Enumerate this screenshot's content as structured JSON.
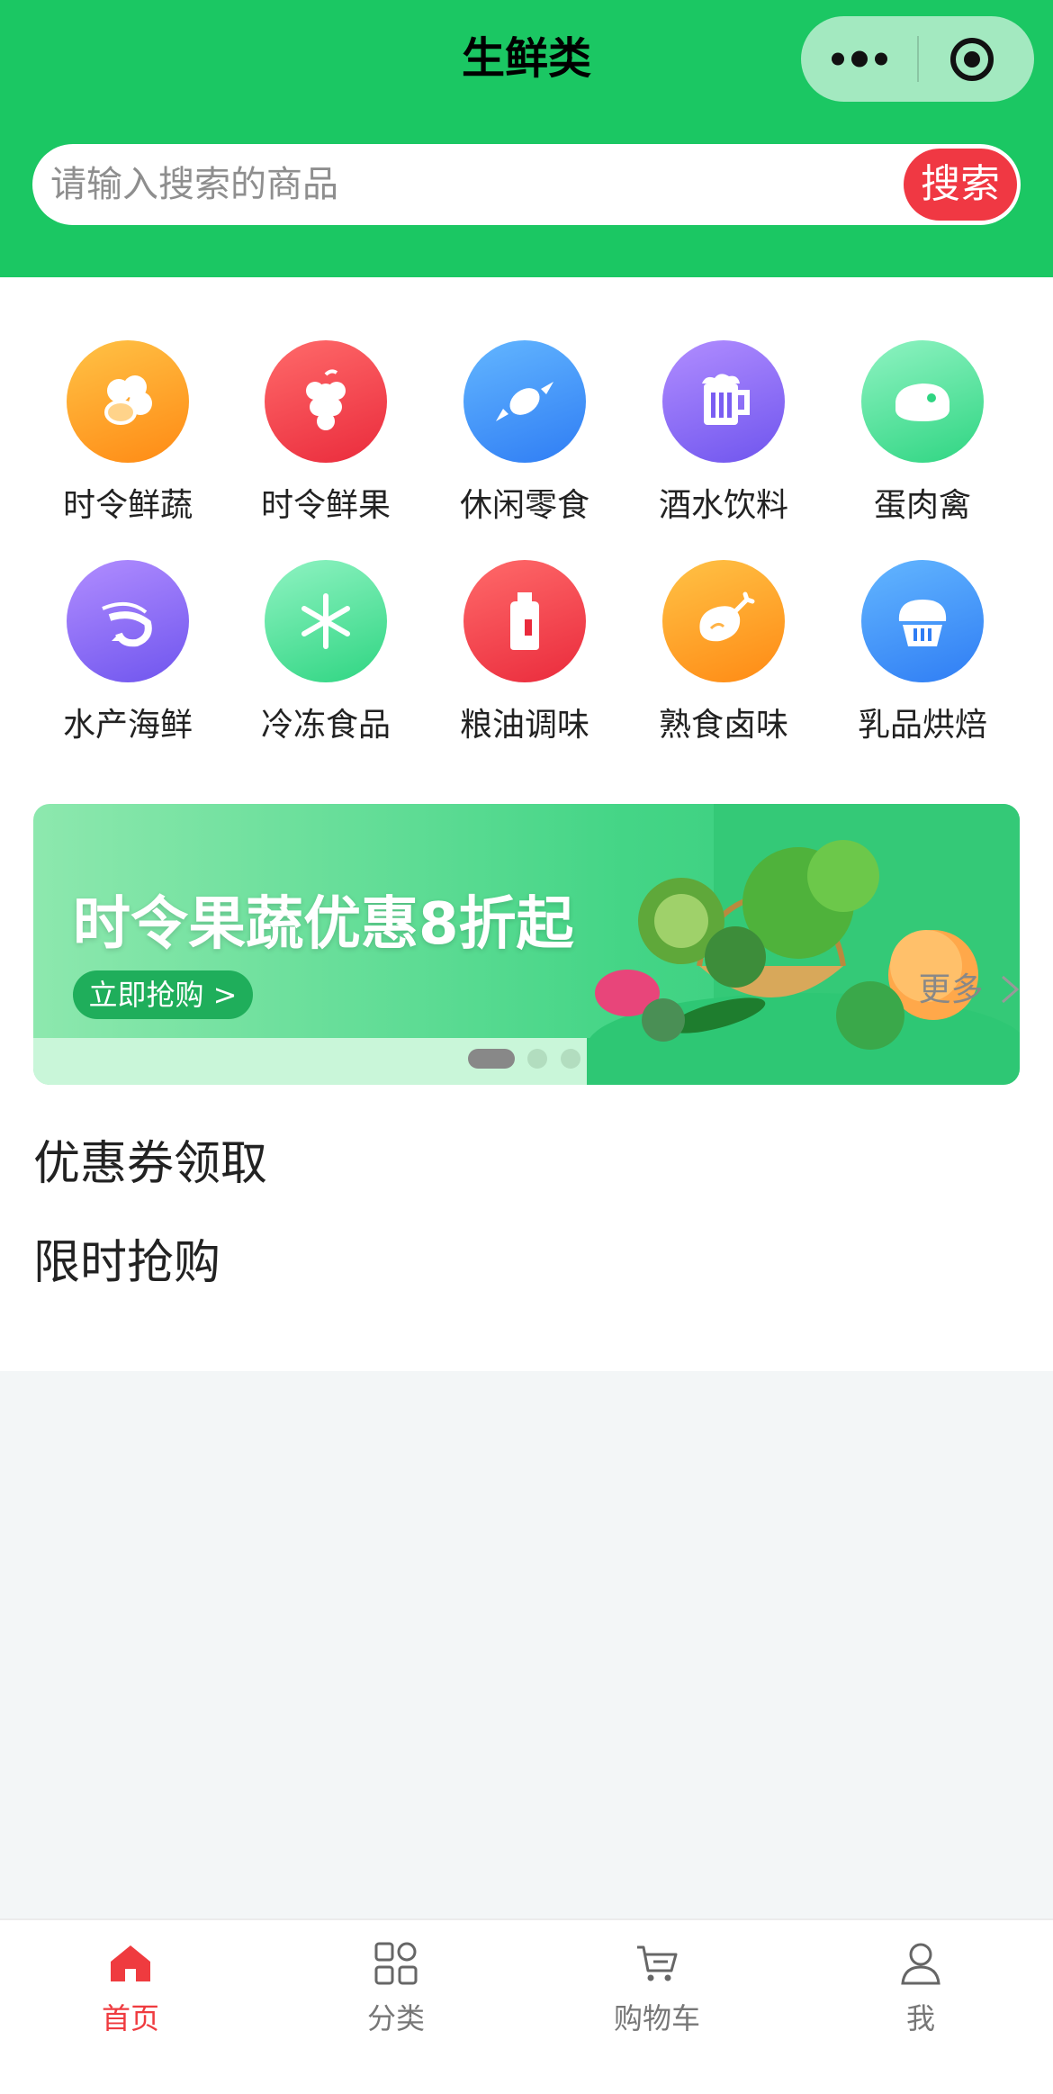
{
  "header": {
    "title": "生鲜类",
    "background_color": "#1bc763",
    "search": {
      "placeholder": "请输入搜索的商品",
      "button_label": "搜索",
      "button_color": "#f03843"
    },
    "capsule": {
      "more_icon": "more-dots-icon",
      "close_icon": "target-icon"
    }
  },
  "categories": [
    {
      "label": "时令鲜蔬",
      "icon": "cauliflower-icon",
      "color": "orange"
    },
    {
      "label": "时令鲜果",
      "icon": "grapes-icon",
      "color": "red"
    },
    {
      "label": "休闲零食",
      "icon": "candy-icon",
      "color": "blue"
    },
    {
      "label": "酒水饮料",
      "icon": "beer-mug-icon",
      "color": "purple"
    },
    {
      "label": "蛋肉禽",
      "icon": "meat-icon",
      "color": "green"
    },
    {
      "label": "水产海鲜",
      "icon": "shrimp-icon",
      "color": "purple"
    },
    {
      "label": "冷冻食品",
      "icon": "snowflake-icon",
      "color": "green"
    },
    {
      "label": "粮油调味",
      "icon": "oil-bottle-icon",
      "color": "red"
    },
    {
      "label": "熟食卤味",
      "icon": "roast-chicken-icon",
      "color": "orange"
    },
    {
      "label": "乳品烘焙",
      "icon": "cupcake-icon",
      "color": "blue"
    }
  ],
  "banner": {
    "headline": "时令果蔬优惠8折起",
    "button_label": "立即抢购 >",
    "slide_count": 3,
    "active_slide": 1
  },
  "sections": {
    "coupon_title": "优惠券领取",
    "flash_sale_title": "限时抢购",
    "more_label": "更多"
  },
  "tabbar": {
    "active_color": "#ef3b3f",
    "items": [
      {
        "label": "首页",
        "icon": "home-icon",
        "active": true
      },
      {
        "label": "分类",
        "icon": "category-grid-icon",
        "active": false
      },
      {
        "label": "购物车",
        "icon": "cart-icon",
        "active": false
      },
      {
        "label": "我",
        "icon": "user-icon",
        "active": false
      }
    ]
  }
}
